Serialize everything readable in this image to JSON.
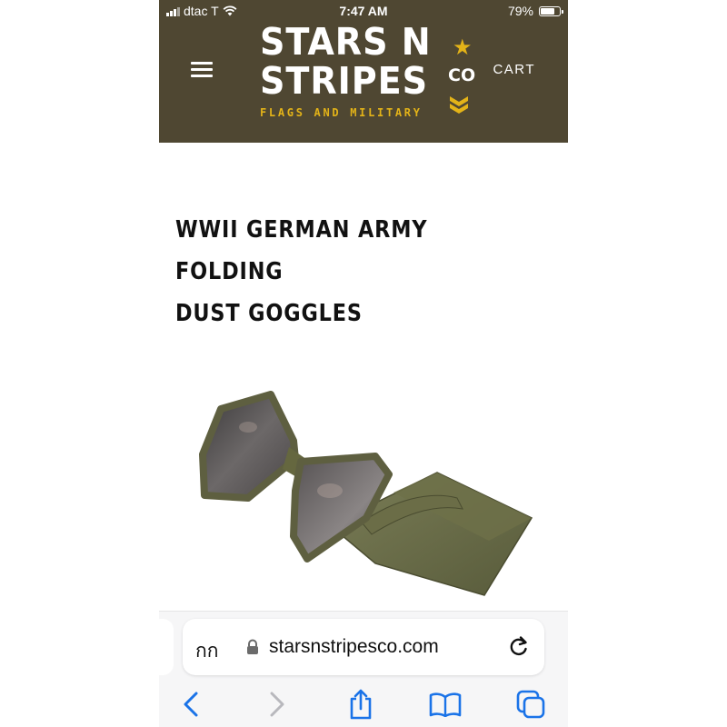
{
  "status_bar": {
    "carrier": "dtac T",
    "time": "7:47 AM",
    "battery": "79%"
  },
  "header": {
    "logo_line1": "STARS N",
    "logo_line2": "STRIPES",
    "logo_co": "CO",
    "logo_tagline": "FLAGS AND MILITARY",
    "cart_label": "CART"
  },
  "product": {
    "title_line1": "WWII GERMAN ARMY FOLDING",
    "title_line2": "DUST GOGGLES"
  },
  "browser": {
    "reader_label": "กก",
    "url": "starsnstripesco.com"
  },
  "colors": {
    "header_bg": "#4f4732",
    "accent_gold": "#e3b318",
    "ios_blue": "#1a73e8"
  },
  "icons": [
    "signal-icon",
    "wifi-icon",
    "battery-icon",
    "menu-icon",
    "star-icon",
    "chevron-stack-icon",
    "lock-icon",
    "reload-icon",
    "back-icon",
    "forward-icon",
    "share-icon",
    "bookmarks-icon",
    "tabs-icon"
  ]
}
